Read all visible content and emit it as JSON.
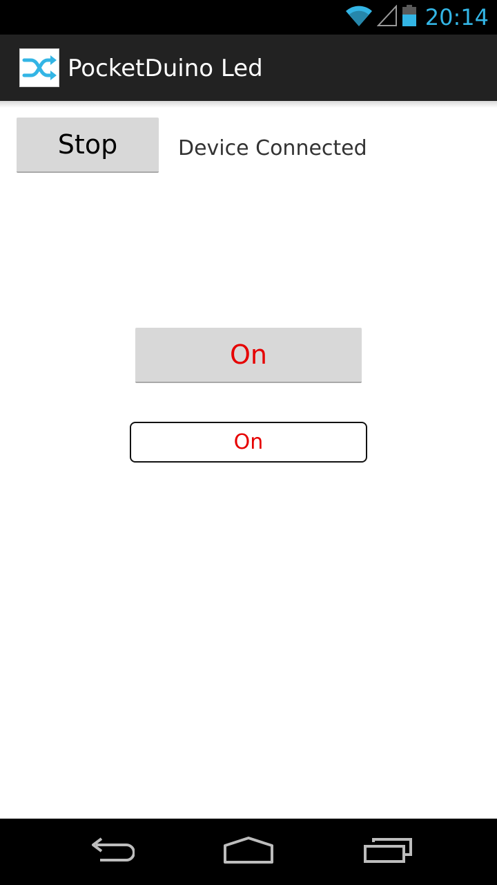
{
  "status_bar": {
    "time": "20:14",
    "icons": [
      "wifi-icon",
      "signal-icon",
      "battery-icon"
    ],
    "accent_color": "#33b5e5"
  },
  "action_bar": {
    "title": "PocketDuino Led",
    "icon": "shuffle-icon",
    "icon_color": "#33b5e5"
  },
  "main": {
    "stop_label": "Stop",
    "connection_status": "Device Connected",
    "led_button_label": "On",
    "led_toggle_label": "On",
    "led_text_color": "#e60000"
  },
  "nav_bar": {
    "icons": [
      "back-icon",
      "home-icon",
      "recent-apps-icon"
    ]
  }
}
